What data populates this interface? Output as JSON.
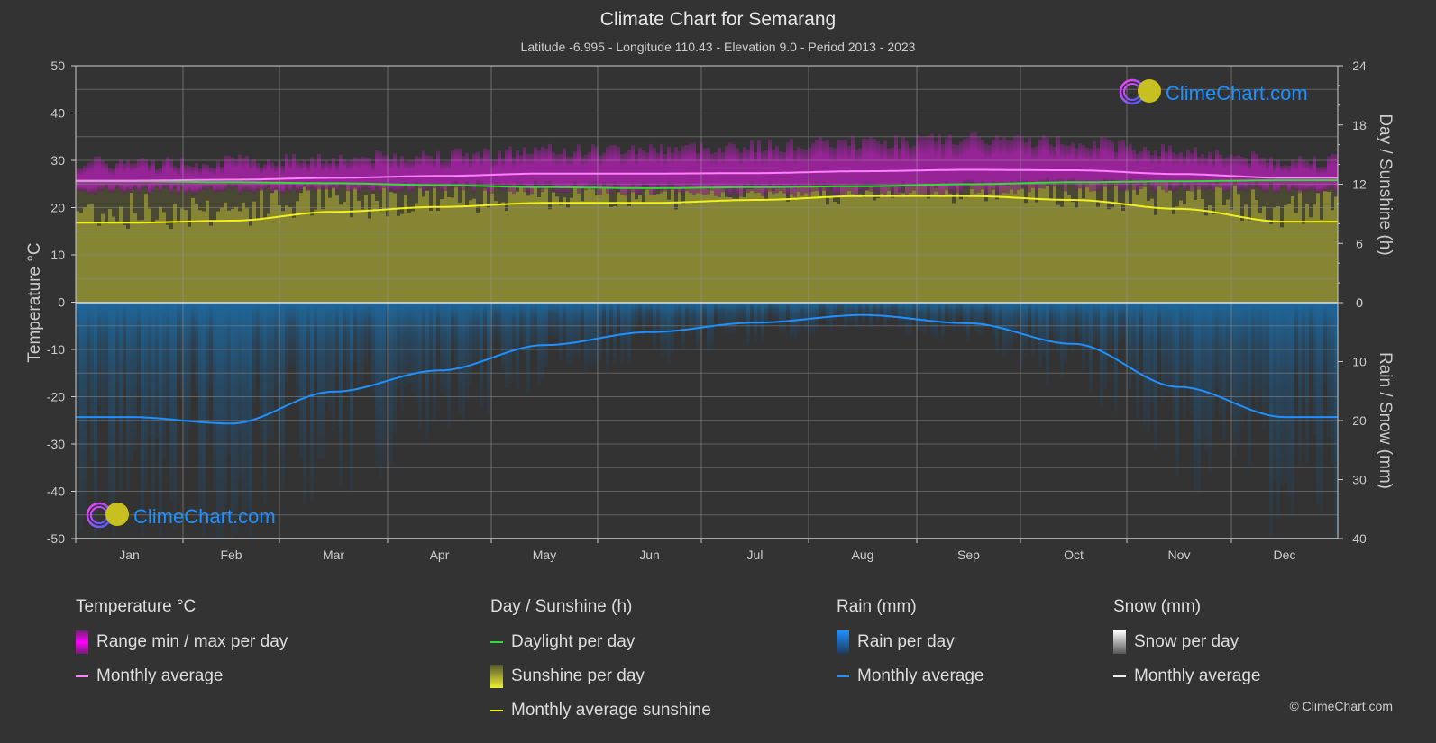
{
  "header": {
    "title": "Climate Chart for Semarang",
    "subtitle": "Latitude -6.995 - Longitude 110.43 - Elevation 9.0 - Period 2013 - 2023"
  },
  "watermark": "ClimeChart.com",
  "copyright": "© ClimeChart.com",
  "colors": {
    "background": "#333333",
    "temp_range": "#c020c0",
    "temp_avg": "#ff80ff",
    "daylight": "#33dd33",
    "sunshine_fill": "#8c8c33",
    "sunshine_avg": "#f0f020",
    "rain_fill": "#1e6aa0",
    "rain_avg": "#1e90ff",
    "brand": "#1e90ff"
  },
  "chart_data": {
    "type": "area",
    "title": "Climate Chart for Semarang",
    "categories": [
      "Jan",
      "Feb",
      "Mar",
      "Apr",
      "May",
      "Jun",
      "Jul",
      "Aug",
      "Sep",
      "Oct",
      "Nov",
      "Dec"
    ],
    "axes": {
      "left": {
        "label": "Temperature °C",
        "range": [
          -50,
          50
        ],
        "ticks": [
          50,
          40,
          30,
          20,
          10,
          0,
          -10,
          -20,
          -30,
          -40,
          -50
        ]
      },
      "right_top": {
        "label": "Day / Sunshine (h)",
        "range": [
          0,
          24
        ],
        "ticks": [
          24,
          18,
          12,
          6,
          0
        ]
      },
      "right_bottom": {
        "label": "Rain / Snow (mm)",
        "range": [
          0,
          40
        ],
        "ticks": [
          0,
          10,
          20,
          30,
          40
        ]
      }
    },
    "grid": true,
    "series": [
      {
        "name": "Temperature monthly average",
        "axis": "left",
        "values": [
          25.7,
          25.9,
          26.3,
          26.7,
          27.2,
          27.2,
          27.3,
          27.7,
          28.0,
          27.9,
          27.1,
          26.3
        ]
      },
      {
        "name": "Temperature range min",
        "axis": "left",
        "values": [
          23.5,
          23.5,
          23.7,
          23.8,
          23.6,
          23.2,
          22.8,
          23.0,
          23.4,
          24.0,
          24.0,
          23.8
        ]
      },
      {
        "name": "Temperature range max",
        "axis": "left",
        "values": [
          29.5,
          29.8,
          30.5,
          31.2,
          32.0,
          32.5,
          33.0,
          33.8,
          34.5,
          34.0,
          32.0,
          30.0
        ]
      },
      {
        "name": "Daylight per day",
        "axis": "right_top",
        "values": [
          12.3,
          12.2,
          12.1,
          11.9,
          11.7,
          11.6,
          11.7,
          11.8,
          12.0,
          12.2,
          12.3,
          12.4
        ]
      },
      {
        "name": "Monthly average sunshine",
        "axis": "right_top",
        "values": [
          8.1,
          8.3,
          9.2,
          9.7,
          10.1,
          10.1,
          10.4,
          10.8,
          10.8,
          10.4,
          9.5,
          8.2
        ]
      },
      {
        "name": "Rain monthly average",
        "axis": "right_bottom",
        "values": [
          19.4,
          20.5,
          15.1,
          11.5,
          7.2,
          5.0,
          3.4,
          2.1,
          3.5,
          7.0,
          14.3,
          19.4
        ]
      }
    ]
  },
  "legend": {
    "temperature": {
      "heading": "Temperature °C",
      "items": [
        "Range min / max per day",
        "Monthly average"
      ]
    },
    "sunshine": {
      "heading": "Day / Sunshine (h)",
      "items": [
        "Daylight per day",
        "Sunshine per day",
        "Monthly average sunshine"
      ]
    },
    "rain": {
      "heading": "Rain (mm)",
      "items": [
        "Rain per day",
        "Monthly average"
      ]
    },
    "snow": {
      "heading": "Snow (mm)",
      "items": [
        "Snow per day",
        "Monthly average"
      ]
    }
  }
}
